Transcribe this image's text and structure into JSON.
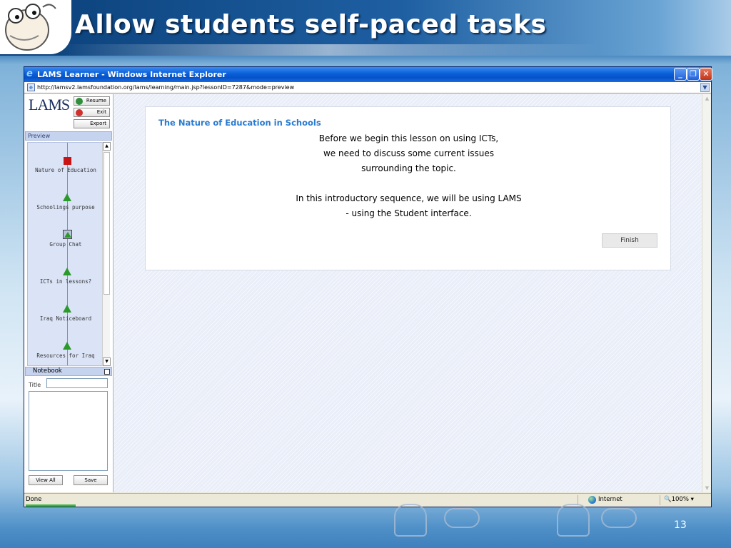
{
  "slide": {
    "title": "Allow students self-paced tasks",
    "page_number": "13"
  },
  "browser": {
    "window_title": "LAMS Learner - Windows Internet Explorer",
    "address": "http://lamsv2.lamsfoundation.org/lams/learning/main.jsp?lessonID=7287&mode=preview",
    "status_text": "Done",
    "zone": "Internet",
    "zoom": "100%"
  },
  "lams": {
    "logo_text": "LAMS",
    "buttons": {
      "resume": "Resume",
      "exit": "Exit",
      "export": "Export"
    },
    "preview_label": "Preview",
    "sequence": [
      {
        "label": "Nature of Education",
        "icon": "red-square-current"
      },
      {
        "label": "Schoolings purpose",
        "icon": "green-triangle"
      },
      {
        "label": "Group Chat",
        "icon": "green-triangle-boxed"
      },
      {
        "label": "ICTs in lessons?",
        "icon": "green-triangle"
      },
      {
        "label": "Iraq Noticeboard",
        "icon": "green-triangle"
      },
      {
        "label": "Resources for Iraq",
        "icon": "green-triangle"
      }
    ],
    "notebook": {
      "header": "Notebook",
      "title_label": "Title",
      "view_all": "View All",
      "save": "Save"
    }
  },
  "activity": {
    "title": "The Nature of Education in Schools",
    "lines": [
      "Before we begin this lesson on using ICTs,",
      "we need to discuss some current issues",
      "surrounding the topic.",
      "",
      "In this introductory sequence, we will be using LAMS",
      "- using the Student interface."
    ],
    "finish_label": "Finish"
  }
}
